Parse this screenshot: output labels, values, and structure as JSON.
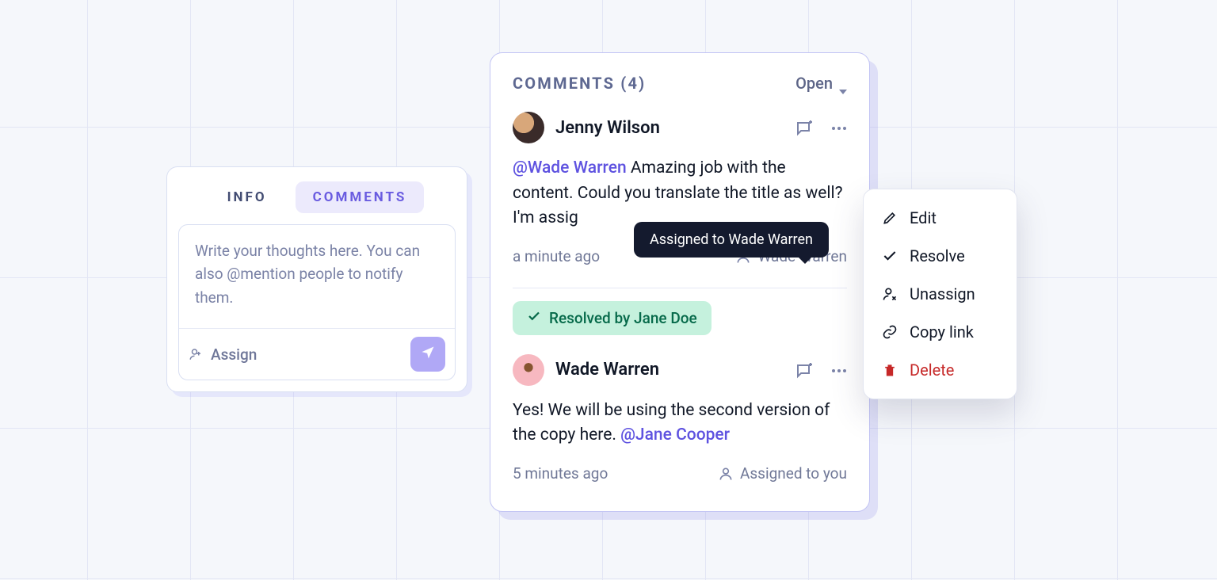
{
  "compose": {
    "tabs": {
      "info": "INFO",
      "comments": "COMMENTS"
    },
    "placeholder": "Write your thoughts here. You can also @mention people to notify them.",
    "assign_label": "Assign"
  },
  "comments_panel": {
    "title": "COMMENTS (4)",
    "filter_label": "Open"
  },
  "comments": [
    {
      "author": "Jenny Wilson",
      "mention": "@Wade Warren",
      "body": " Amazing job with the content. Could you translate the title as well? I'm assig",
      "time": "a minute ago",
      "assignee": "Wade Warren"
    },
    {
      "resolved_by": "Resolved by Jane Doe",
      "author": "Wade Warren",
      "body_pre": "Yes! We will be using the second version of the copy here. ",
      "mention": "@Jane Cooper",
      "time": "5 minutes ago",
      "assignee": "Assigned to you"
    }
  ],
  "tooltip": "Assigned to Wade Warren",
  "menu": {
    "edit": "Edit",
    "resolve": "Resolve",
    "unassign": "Unassign",
    "copy_link": "Copy link",
    "delete": "Delete"
  },
  "avatar_colors": {
    "jenny": "#3a2b2a",
    "wade": "#f7b8c0"
  }
}
